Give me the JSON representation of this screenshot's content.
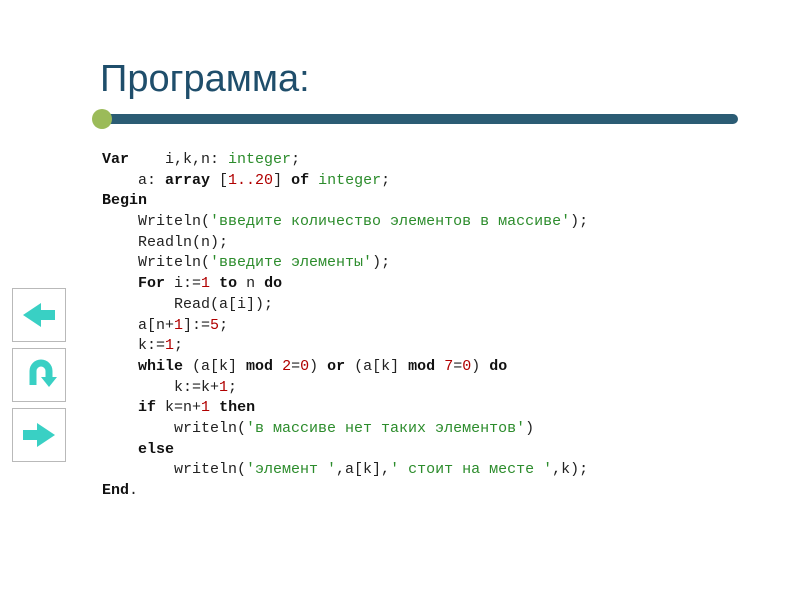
{
  "title": "Программа:",
  "nav": {
    "prev_alt": "previous",
    "home_alt": "home",
    "next_alt": "next"
  },
  "code": {
    "l1a": "Var",
    "l1b": "    i,k,n: ",
    "l1c": "integer",
    "l1d": ";",
    "l2a": "    a: ",
    "l2b": "array",
    "l2c": " [",
    "l2d": "1..20",
    "l2e": "] ",
    "l2f": "of",
    "l2g": " ",
    "l2h": "integer",
    "l2i": ";",
    "l3a": "Begin",
    "l4a": "    Writeln(",
    "l4b": "'введите количество элементов в массиве'",
    "l4c": ");",
    "l5a": "    Readln(n);",
    "l6a": "    Writeln(",
    "l6b": "'введите элементы'",
    "l6c": ");",
    "l7a": "    ",
    "l7b": "For",
    "l7c": " i:=",
    "l7d": "1",
    "l7e": " ",
    "l7f": "to",
    "l7g": " n ",
    "l7h": "do",
    "l8a": "        Read(a[i]);",
    "l9a": "    a[n+",
    "l9b": "1",
    "l9c": "]:=",
    "l9d": "5",
    "l9e": ";",
    "l10a": "    k:=",
    "l10b": "1",
    "l10c": ";",
    "l11a": "    ",
    "l11b": "while",
    "l11c": " (a[k] ",
    "l11d": "mod",
    "l11e": " ",
    "l11f": "2",
    "l11g": "=",
    "l11h": "0",
    "l11i": ") ",
    "l11j": "or",
    "l11k": " (a[k] ",
    "l11l": "mod",
    "l11m": " ",
    "l11n": "7",
    "l11o": "=",
    "l11p": "0",
    "l11q": ") ",
    "l11r": "do",
    "l12a": "        k:=k+",
    "l12b": "1",
    "l12c": ";",
    "l13a": "    ",
    "l13b": "if",
    "l13c": " k=n+",
    "l13d": "1",
    "l13e": " ",
    "l13f": "then",
    "l14a": "        writeln(",
    "l14b": "'в массиве нет таких элементов'",
    "l14c": ")",
    "l15a": "    ",
    "l15b": "else",
    "l16a": "        writeln(",
    "l16b": "'элемент '",
    "l16c": ",a[k],",
    "l16d": "' стоит на месте '",
    "l16e": ",k);",
    "l17a": "End",
    "l17b": "."
  }
}
